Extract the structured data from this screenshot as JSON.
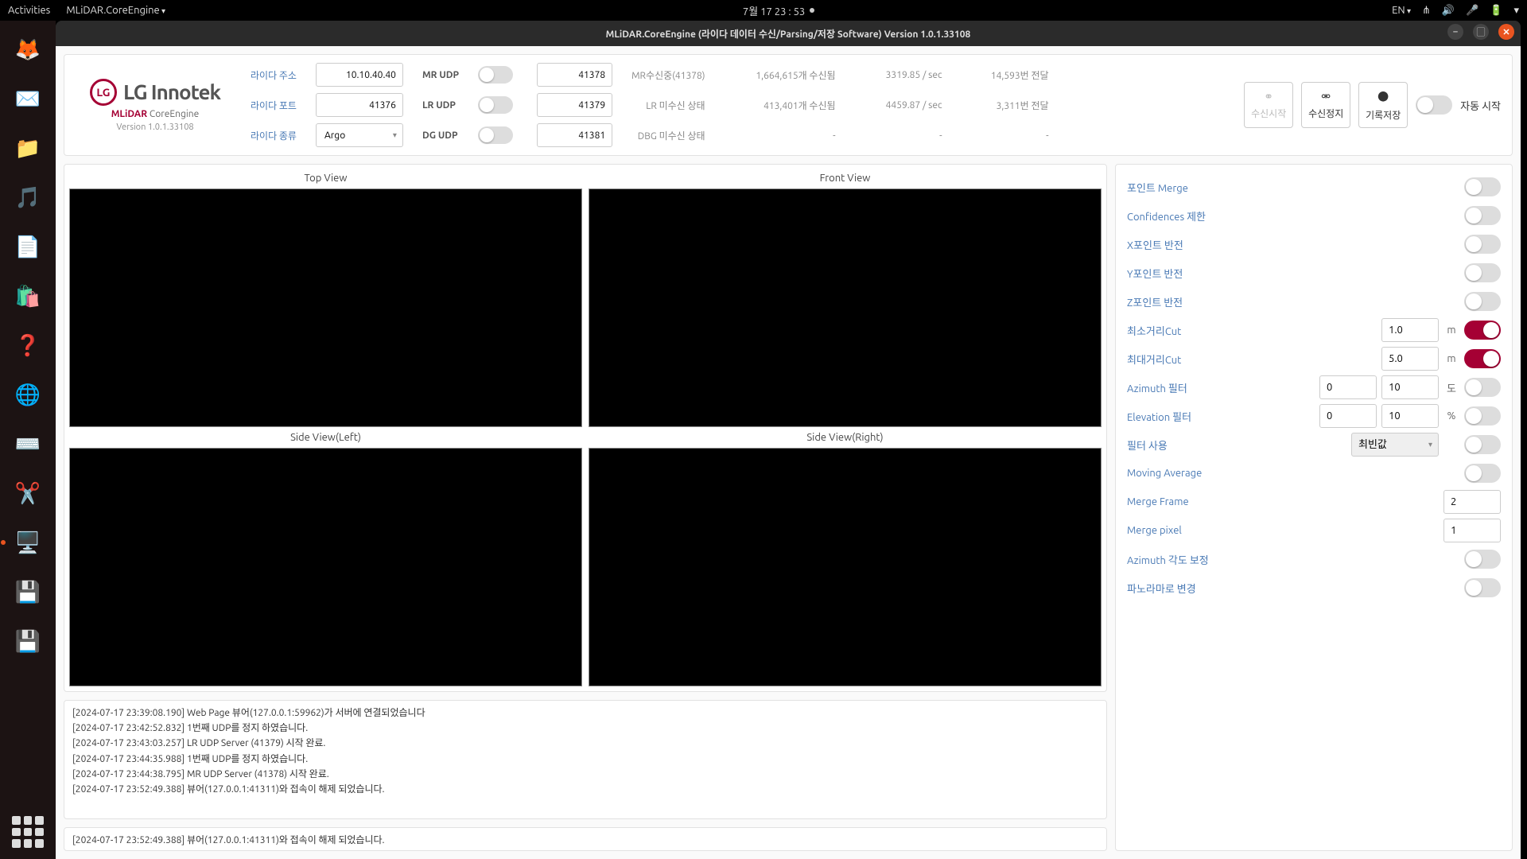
{
  "gnome": {
    "activities": "Activities",
    "app_menu": "MLiDAR.CoreEngine",
    "clock": "7월 17  23 : 53",
    "lang": "EN"
  },
  "window": {
    "title": "MLiDAR.CoreEngine (라이다 데이터 수신/Parsing/저장 Software) Version 1.0.1.33108"
  },
  "logo": {
    "brand": "LG Innotek",
    "app": "MLiDAR",
    "suffix": "CoreEngine",
    "version": "Version 1.0.1.33108"
  },
  "header": {
    "lidar_addr_lbl": "라이다 주소",
    "lidar_addr": "10.10.40.40",
    "lidar_port_lbl": "라이다 포트",
    "lidar_port": "41376",
    "lidar_kind_lbl": "라이다 종류",
    "lidar_kind": "Argo",
    "mr_udp_lbl": "MR UDP",
    "mr_port": "41378",
    "lr_udp_lbl": "LR UDP",
    "lr_port": "41379",
    "dg_udp_lbl": "DG UDP",
    "dg_port": "41381",
    "stats": [
      [
        "MR수신중(41378)",
        "1,664,615개 수신됨",
        "3319.85 / sec",
        "14,593번 전달"
      ],
      [
        "LR 미수신 상태",
        "413,401개 수신됨",
        "4459.87 / sec",
        "3,311번 전달"
      ],
      [
        "DBG 미수신 상태",
        "-",
        "-",
        "-"
      ]
    ],
    "btn_start": "수신시작",
    "btn_stop": "수신정지",
    "btn_save": "기록저장",
    "auto_start": "자동 시작"
  },
  "views": {
    "top": "Top View",
    "front": "Front View",
    "side_l": "Side View(Left)",
    "side_r": "Side View(Right)"
  },
  "logs": [
    "[2024-07-17 23:39:08.190] Web Page 뷰어(127.0.0.1:59962)가 서버에 연결되었습니다",
    "[2024-07-17 23:42:52.832] 1번째 UDP를 정지 하였습니다.",
    "[2024-07-17 23:43:03.257] LR UDP Server (41379)  시작 완료.",
    "[2024-07-17 23:44:35.988] 1번째 UDP를 정지 하였습니다.",
    "[2024-07-17 23:44:38.795] MR UDP Server (41378)  시작 완료.",
    "[2024-07-17 23:52:49.388] 뷰어(127.0.0.1:41311)와 접속이 해제 되었습니다."
  ],
  "status": "[2024-07-17 23:52:49.388] 뷰어(127.0.0.1:41311)와 접속이 해제 되었습니다.",
  "side": {
    "point_merge": "포인트 Merge",
    "conf_limit": "Confidences 제한",
    "x_invert": "X포인트 반전",
    "y_invert": "Y포인트 반전",
    "z_invert": "Z포인트 반전",
    "min_cut": "최소거리Cut",
    "min_cut_val": "1.0",
    "max_cut": "최대거리Cut",
    "max_cut_val": "5.0",
    "az_filter": "Azimuth 필터",
    "az_lo": "0",
    "az_hi": "10",
    "el_filter": "Elevation 필터",
    "el_lo": "0",
    "el_hi": "10",
    "filter_use": "필터 사용",
    "filter_use_val": "최빈값",
    "mov_avg": "Moving Average",
    "merge_frame": "Merge Frame",
    "merge_frame_val": "2",
    "merge_pixel": "Merge pixel",
    "merge_pixel_val": "1",
    "az_angle": "Azimuth 각도 보정",
    "panorama": "파노라마로 변경",
    "unit_m": "m",
    "unit_deg": "도",
    "unit_pct": "%"
  }
}
